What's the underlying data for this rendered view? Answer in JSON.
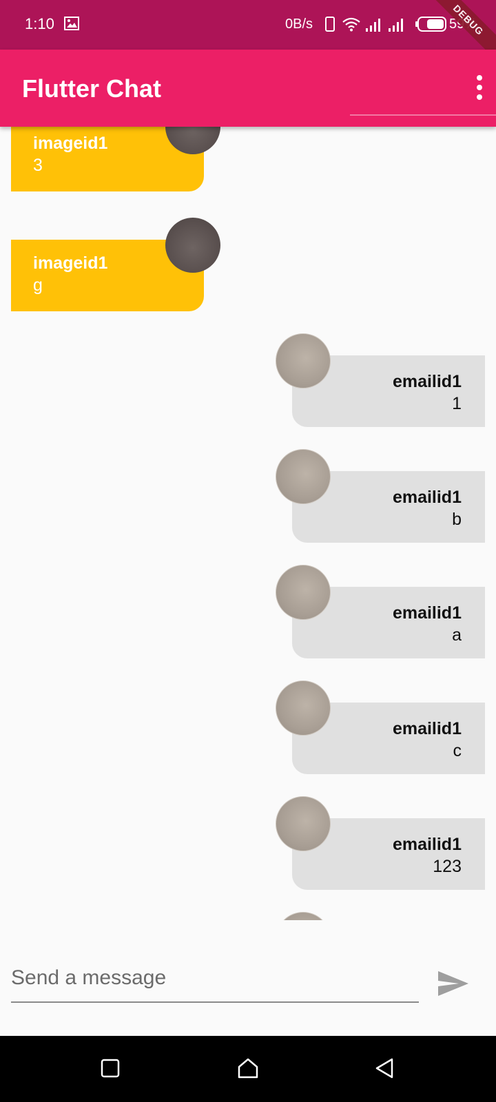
{
  "status_bar": {
    "time": "1:10",
    "net_speed": "0B/s",
    "battery": "59%",
    "icons": [
      "gallery-icon",
      "phone-icon",
      "wifi-icon",
      "signal-icon",
      "signal-icon",
      "battery-icon"
    ]
  },
  "debug_banner": "DEBUG",
  "app_bar": {
    "title": "Flutter Chat",
    "menu_icon": "more-vertical-icon",
    "color": "#ec1f66"
  },
  "messages": [
    {
      "side": "left",
      "name": "imageid1",
      "text": "3"
    },
    {
      "side": "left",
      "name": "imageid1",
      "text": "g"
    },
    {
      "side": "right",
      "name": "emailid1",
      "text": "1"
    },
    {
      "side": "right",
      "name": "emailid1",
      "text": "b"
    },
    {
      "side": "right",
      "name": "emailid1",
      "text": "a"
    },
    {
      "side": "right",
      "name": "emailid1",
      "text": "c"
    },
    {
      "side": "right",
      "name": "emailid1",
      "text": "123"
    }
  ],
  "colors": {
    "status_bar": "#ad1457",
    "left_bubble": "#ffc107",
    "right_bubble": "#e0e0e0"
  },
  "composer": {
    "placeholder": "Send a message",
    "send_icon": "send-icon"
  },
  "nav_bar": {
    "icons": [
      "recents-icon",
      "home-icon",
      "back-icon"
    ]
  }
}
